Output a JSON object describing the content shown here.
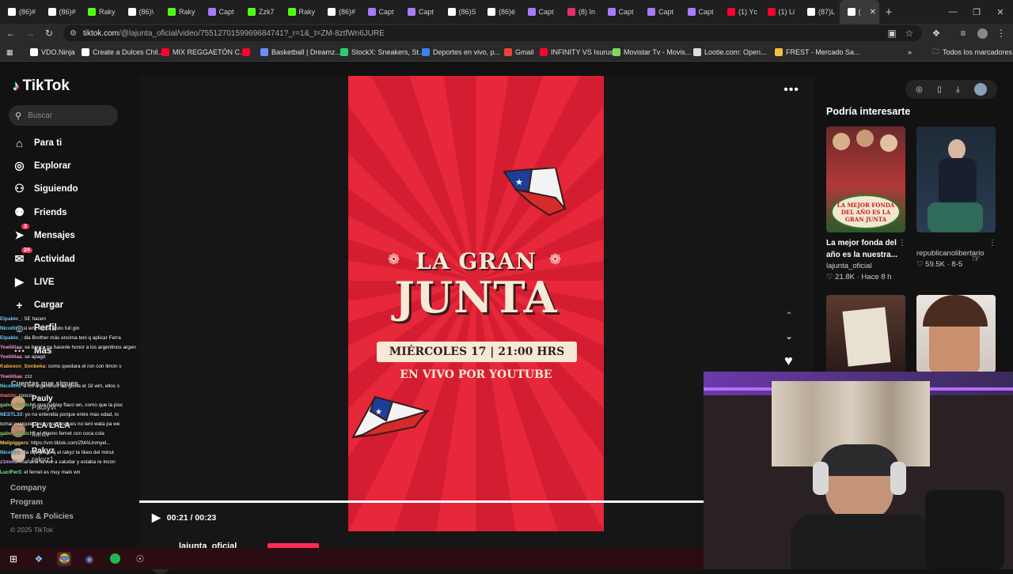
{
  "browser": {
    "tabs": [
      {
        "label": "(86)#",
        "color": "#ffffff",
        "active": false
      },
      {
        "label": "(86)#",
        "color": "#ffffff",
        "active": false
      },
      {
        "label": "Raky",
        "color": "#53fc18",
        "active": false
      },
      {
        "label": "(86)\\",
        "color": "#ffffff",
        "active": false
      },
      {
        "label": "Raky",
        "color": "#53fc18",
        "active": false
      },
      {
        "label": "Capt",
        "color": "#a77cf5",
        "active": false
      },
      {
        "label": "Zzk7",
        "color": "#53fc18",
        "active": false
      },
      {
        "label": "Raky",
        "color": "#53fc18",
        "active": false
      },
      {
        "label": "(86)#",
        "color": "#ffffff",
        "active": false
      },
      {
        "label": "Capt",
        "color": "#a77cf5",
        "active": false
      },
      {
        "label": "Capt",
        "color": "#a77cf5",
        "active": false
      },
      {
        "label": "(86)S",
        "color": "#ffffff",
        "active": false
      },
      {
        "label": "(86)é",
        "color": "#ffffff",
        "active": false
      },
      {
        "label": "Capt",
        "color": "#a77cf5",
        "active": false
      },
      {
        "label": "(8) In",
        "color": "#e1306c",
        "active": false
      },
      {
        "label": "Capt",
        "color": "#a77cf5",
        "active": false
      },
      {
        "label": "Capt",
        "color": "#a77cf5",
        "active": false
      },
      {
        "label": "Capt",
        "color": "#a77cf5",
        "active": false
      },
      {
        "label": "(1) Yc",
        "color": "#ff0033",
        "active": false
      },
      {
        "label": "(1) Li",
        "color": "#ff0033",
        "active": false
      },
      {
        "label": "(87)L",
        "color": "#ffffff",
        "active": false
      },
      {
        "label": "(",
        "color": "#ffffff",
        "active": true
      }
    ],
    "new_tab": "+",
    "url_host": "tiktok.com",
    "url_path": "/@lajunta_oficial/video/7551270159969684741?_r=1&_t=ZM-8ztfWn6JURE",
    "bookmarks": [
      {
        "label": "VDO.Ninja",
        "color": "#ffffff"
      },
      {
        "label": "Create a Dulces Chil...",
        "color": "#ffffff"
      },
      {
        "label": "MIX REGGAETÓN C...",
        "color": "#ff0033"
      },
      {
        "label": "",
        "color": "#ff0033"
      },
      {
        "label": "Basketball | Dreamz...",
        "color": "#6a8cff"
      },
      {
        "label": "StockX: Sneakers, St...",
        "color": "#2ecc71"
      },
      {
        "label": "Deportes en vivo, p...",
        "color": "#3b82f6"
      },
      {
        "label": "Gmail",
        "color": "#ea4335"
      },
      {
        "label": "INFINITY VS Isurus",
        "color": "#ff0033"
      },
      {
        "label": "Movistar Tv - Movis...",
        "color": "#7ed957"
      },
      {
        "label": "Lootie.com: Open...",
        "color": "#dddddd"
      },
      {
        "label": "FREST - Mercado Sa...",
        "color": "#f0c040"
      }
    ],
    "bookmarks_more": "»",
    "all_bookmarks": "Todos los marcadores"
  },
  "sidebar": {
    "logo": "TikTok",
    "search_placeholder": "Buscar",
    "nav": [
      {
        "label": "Para ti",
        "icon": "⌂"
      },
      {
        "label": "Explorar",
        "icon": "◎"
      },
      {
        "label": "Siguiendo",
        "icon": "⚇"
      },
      {
        "label": "Friends",
        "icon": "⚉"
      },
      {
        "label": "Mensajes",
        "icon": "➤"
      },
      {
        "label": "Actividad",
        "icon": "✉"
      },
      {
        "label": "LIVE",
        "icon": "▶"
      },
      {
        "label": "Cargar",
        "icon": "+"
      },
      {
        "label": "Perfil",
        "icon": "☺"
      },
      {
        "label": "Más",
        "icon": "⋯"
      }
    ],
    "badge_messages": "3",
    "badge_activity": "24",
    "following_header": "Cuentas que sigues",
    "following": [
      {
        "name": "Pauly",
        "handle": "Paulyvl",
        "color": "#c9a07a"
      },
      {
        "name": "FLA LALA",
        "handle": "fla.dv",
        "color": "#b88a6a"
      },
      {
        "name": "Rakyz",
        "handle": "rakyz1",
        "color": "#d8b8a0"
      }
    ],
    "footer": [
      "Company",
      "Program",
      "Terms & Policies"
    ],
    "copyright": "© 2025 TikTok"
  },
  "chat": [
    {
      "user": "Elpablo_",
      "text": "SE hacen",
      "color": "#7ec8ff"
    },
    {
      "user": "Nicolitro",
      "text": "si wm ahora ando full gin",
      "color": "#6fd3ff"
    },
    {
      "user": "Elpablo_",
      "text": "dia Brother más encima teni q aplicar Ferra",
      "color": "#7ec8ff"
    },
    {
      "user": "Yoeliitiaa",
      "text": "se banca pa hacerle honor a los argentinos argentinas",
      "color": "#ff9ad5"
    },
    {
      "user": "Yoeliitiaa",
      "text": "se apagó",
      "color": "#ff9ad5"
    },
    {
      "user": "Kabeson_Sonbeka",
      "text": "como quedara el ron con limon s",
      "color": "#ffb347"
    },
    {
      "user": "Yoeliitiaa",
      "text": "zzz",
      "color": "#ff9ad5"
    },
    {
      "user": "Nicolitro",
      "text": "a los argentinos les gusta el 18 wm, ellos s",
      "color": "#6fd3ff"
    },
    {
      "user": "maizin",
      "text": "cosccu",
      "color": "#ff7a7a"
    },
    {
      "user": "gabo_scratcht",
      "text": "que hablay flaco wn, como que la pisc",
      "color": "#9ad17a"
    },
    {
      "user": "NESTL33",
      "text": "yo no entendia porque entre mas edad, lo",
      "color": "#7ec8ff"
    },
    {
      "user": "",
      "text": "tomai cualquier wea y ya despues no teni wata pa we",
      "color": "#ffffff"
    },
    {
      "user": "gabo_scratcht",
      "text": "el mismo fernet con coca cola",
      "color": "#9ad17a"
    },
    {
      "user": "Melipiggers",
      "text": "https://vm.tiktok.com/ZMAUnmyel...",
      "color": "#ffd166"
    },
    {
      "user": "Nicolitro",
      "text": "fla dijo pinas q el rakyz te likeo del minut",
      "color": "#6fd3ff"
    },
    {
      "user": "z1mm3",
      "text": "mañana le vue a saludar y estaba re incon",
      "color": "#c9a7ff"
    },
    {
      "user": "LuciFer3",
      "text": "el fernet es muy malo wn",
      "color": "#7effa8"
    }
  ],
  "player": {
    "poster_line1": "LA GRAN",
    "poster_line2": "JUNTA",
    "poster_date": "MIÉRCOLES 17 | 21:00 HRS",
    "poster_live": "EN VIVO POR YOUTUBE",
    "time": "00:21 / 00:23",
    "progress": 0.9,
    "author": "lajunta_oficial"
  },
  "recommend": {
    "title": "Podría interesarte",
    "cards": [
      {
        "title": "La mejor fonda del año es la nuestra...",
        "user": "lajunta_oficial",
        "meta": "♡ 21.8K · Hace 8 h",
        "thumb_text": "LA MEJOR FONDA DEL AÑO ES LA GRAN JUNTA"
      },
      {
        "title": "",
        "user": "republicanolibertario",
        "meta": "♡ 59.5K · 8-5",
        "thumb_text": ""
      },
      {
        "title": "",
        "user": "",
        "meta": "",
        "thumb_text": ""
      },
      {
        "title": "",
        "user": "",
        "meta": "",
        "thumb_text": ""
      }
    ]
  }
}
